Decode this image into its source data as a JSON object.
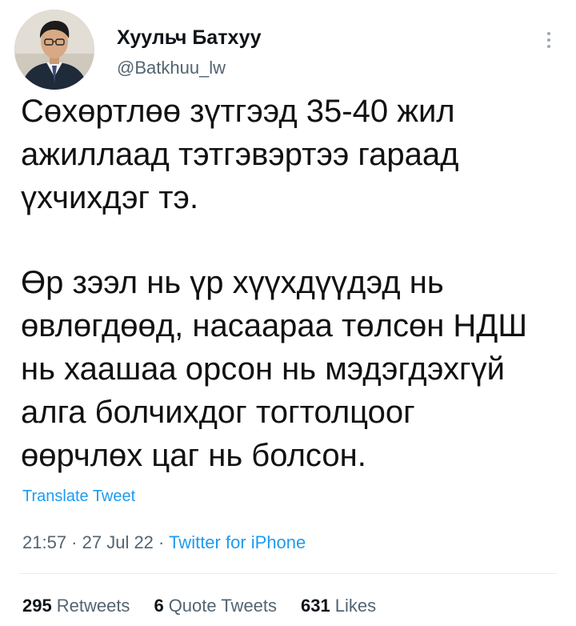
{
  "author": {
    "display_name": "Хуульч Батхуу",
    "handle": "@Batkhuu_lw",
    "avatar_icon": "profile-photo"
  },
  "more_icon": "more-vertical-icon",
  "tweet": {
    "paragraphs": [
      "Сөхөртлөө зүтгээд 35-40 жил\nажиллаад тэтгэвэртээ гараад\nүхчихдэг тэ.",
      "Өр зээл нь үр хүүхдүүдэд нь\nөвлөгдөөд, насаараа төлсөн НДШ\nнь хаашаа орсон нь мэдэгдэхгүй\nалга болчихдог тогтолцоог\nөөрчлөх цаг нь болсон."
    ],
    "translate_label": "Translate Tweet"
  },
  "meta": {
    "time": "21:57",
    "date": "27 Jul 22",
    "separator": " · ",
    "source": "Twitter for iPhone"
  },
  "stats": {
    "retweets_count": "295",
    "retweets_label": "Retweets",
    "quotes_count": "6",
    "quotes_label": "Quote Tweets",
    "likes_count": "631",
    "likes_label": "Likes"
  },
  "colors": {
    "link": "#1d9bf0",
    "secondary_text": "#536471",
    "primary_text": "#0f1419"
  }
}
